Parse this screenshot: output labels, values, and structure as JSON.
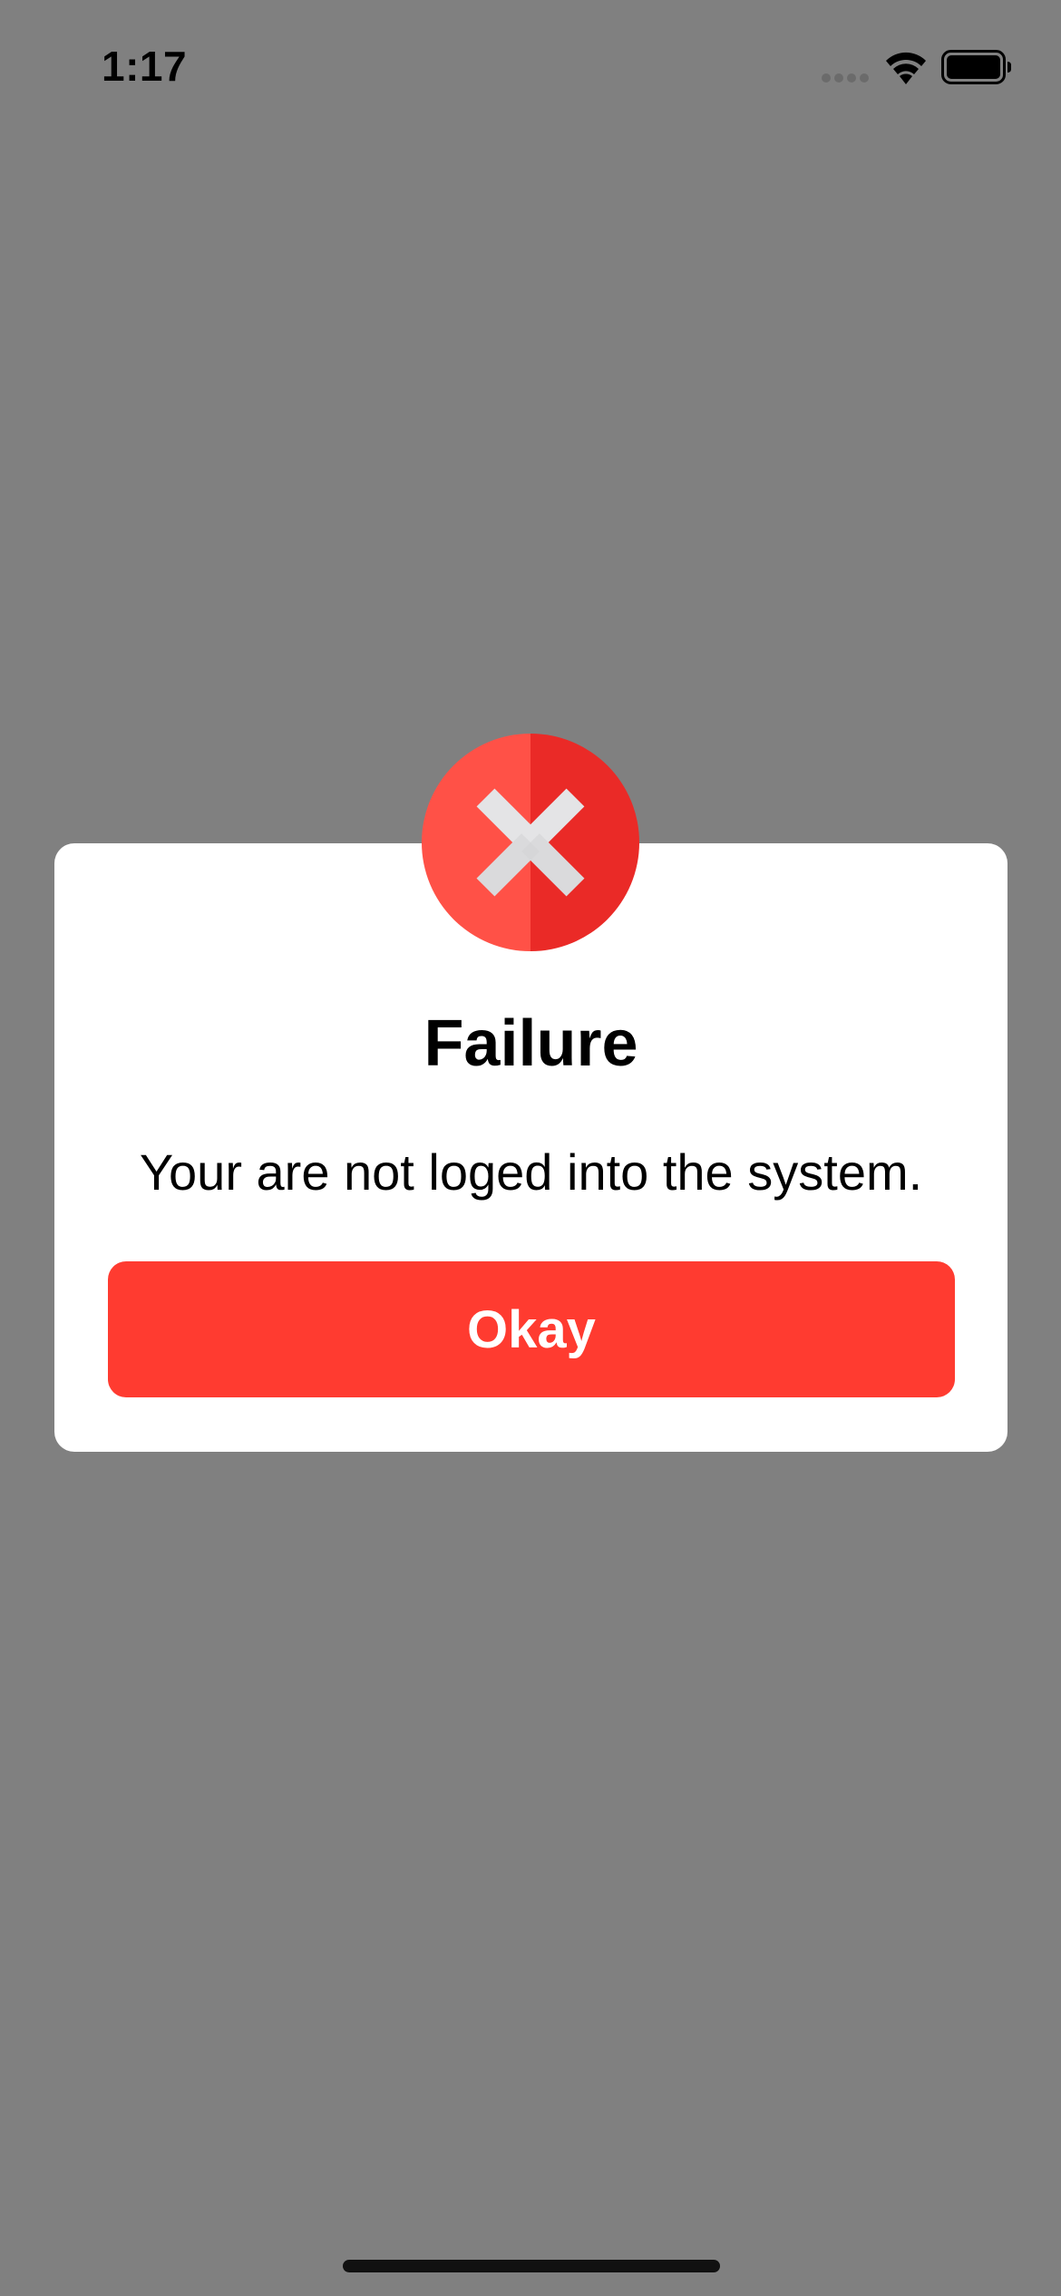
{
  "status_bar": {
    "time": "1:17",
    "icons": [
      "cellular-signal-icon",
      "wifi-icon",
      "battery-icon"
    ]
  },
  "dialog": {
    "icon": "error-x-icon",
    "title": "Failure",
    "message": "Your are not loged into the system.",
    "button_label": "Okay"
  },
  "colors": {
    "overlay": "#808080",
    "accent_red": "#ff3b30",
    "badge_light": "#ff5147",
    "badge_dark": "#ea2a27",
    "x_mark": "#e4e4e6",
    "dialog_bg": "#ffffff"
  }
}
